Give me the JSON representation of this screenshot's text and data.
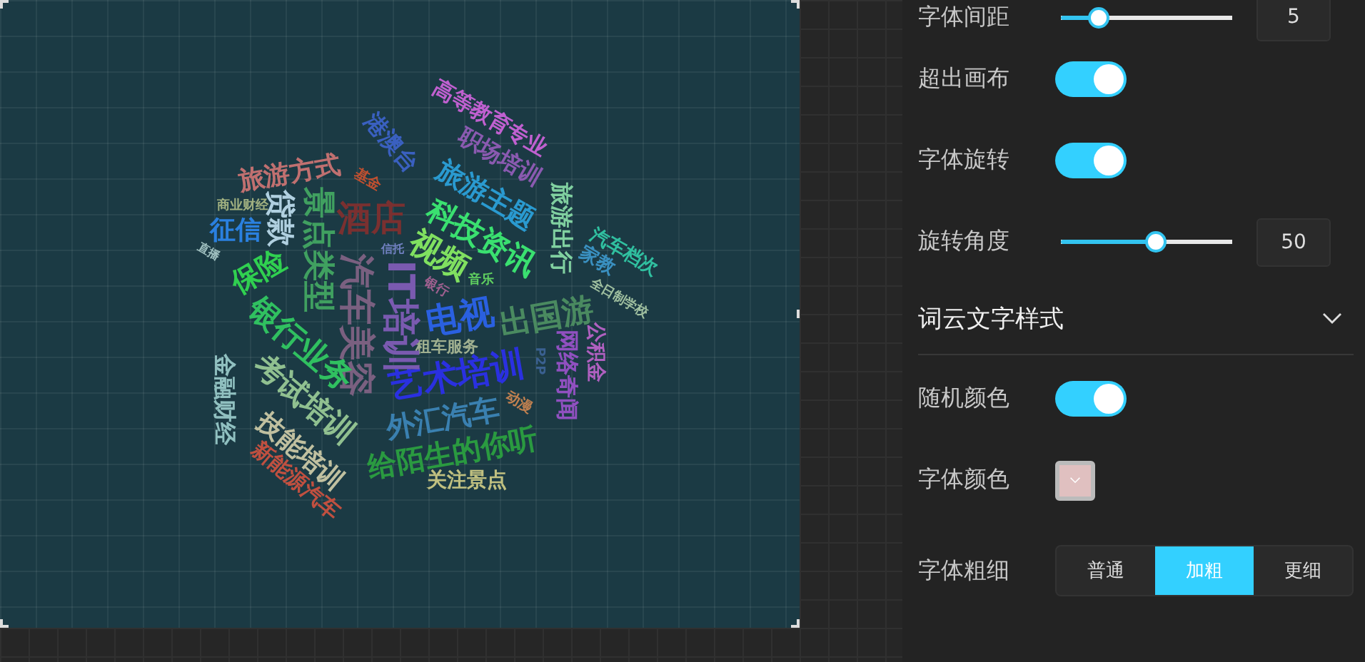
{
  "word_cloud": {
    "words": [
      {
        "text": "高等教育专业",
        "color": "#c060d0"
      },
      {
        "text": "职场培训",
        "color": "#8a5ab0"
      },
      {
        "text": "旅游主题",
        "color": "#2a9ad0"
      },
      {
        "text": "科技资讯",
        "color": "#3ae070"
      },
      {
        "text": "视频",
        "color": "#80e060"
      },
      {
        "text": "旅游出行",
        "color": "#80d0a0"
      },
      {
        "text": "汽车档次",
        "color": "#30c0a0"
      },
      {
        "text": "家教",
        "color": "#3a90c0"
      },
      {
        "text": "全日制学校",
        "color": "#a0c0a0"
      },
      {
        "text": "电视",
        "color": "#2a60e0"
      },
      {
        "text": "出国游",
        "color": "#4a8a60"
      },
      {
        "text": "公积金",
        "color": "#b060c0"
      },
      {
        "text": "网络奇闻",
        "color": "#9050c0"
      },
      {
        "text": "P2P",
        "color": "#3a6090"
      },
      {
        "text": "租车服务",
        "color": "#a0b090"
      },
      {
        "text": "艺术培训",
        "color": "#2a30e0"
      },
      {
        "text": "动漫",
        "color": "#c08050"
      },
      {
        "text": "外汇汽车",
        "color": "#3a80b0"
      },
      {
        "text": "给陌生的你听",
        "color": "#2a9a40"
      },
      {
        "text": "关注景点",
        "color": "#c0c080"
      },
      {
        "text": "音乐",
        "color": "#60d060"
      },
      {
        "text": "银行",
        "color": "#a06090"
      },
      {
        "text": "信托",
        "color": "#7080c0"
      },
      {
        "text": "IT培训",
        "color": "#7a5ab0"
      },
      {
        "text": "汽车美容",
        "color": "#7a6080"
      },
      {
        "text": "港澳台",
        "color": "#3a60c0"
      },
      {
        "text": "旅游方式",
        "color": "#c07070"
      },
      {
        "text": "基金",
        "color": "#c05030"
      },
      {
        "text": "商业财经",
        "color": "#a0b080"
      },
      {
        "text": "征信",
        "color": "#2a80e0"
      },
      {
        "text": "贷款",
        "color": "#b0d0e0"
      },
      {
        "text": "景点类型",
        "color": "#40a060"
      },
      {
        "text": "酒店",
        "color": "#7a3030"
      },
      {
        "text": "保险",
        "color": "#30d050"
      },
      {
        "text": "直播",
        "color": "#a0c0c0"
      },
      {
        "text": "银行业务",
        "color": "#30c060"
      },
      {
        "text": "考试培训",
        "color": "#90c090"
      },
      {
        "text": "金融财经",
        "color": "#90c0c0"
      },
      {
        "text": "技能培训",
        "color": "#c0c0a0"
      },
      {
        "text": "新能源汽车",
        "color": "#c05040"
      }
    ]
  },
  "settings": [
    {
      "kind": "slider",
      "label": "字体间距",
      "level": 0.22,
      "value": "5"
    },
    {
      "kind": "toggle",
      "label": "超出画布",
      "on": true
    },
    {
      "kind": "toggle",
      "label": "字体旋转",
      "on": true
    },
    {
      "kind": "slider",
      "label": "旋转角度",
      "level": 0.55,
      "value": "50"
    },
    {
      "kind": "section",
      "label": "词云文字样式",
      "expanded": true
    },
    {
      "kind": "toggle",
      "label": "随机颜色",
      "on": true
    },
    {
      "kind": "color",
      "label": "字体颜色",
      "color": "#e0c0c0"
    },
    {
      "kind": "segmented",
      "label": "字体粗细",
      "options": [
        {
          "label": "普通",
          "selected": false
        },
        {
          "label": "加粗",
          "selected": true
        },
        {
          "label": "更细",
          "selected": false
        }
      ]
    }
  ]
}
